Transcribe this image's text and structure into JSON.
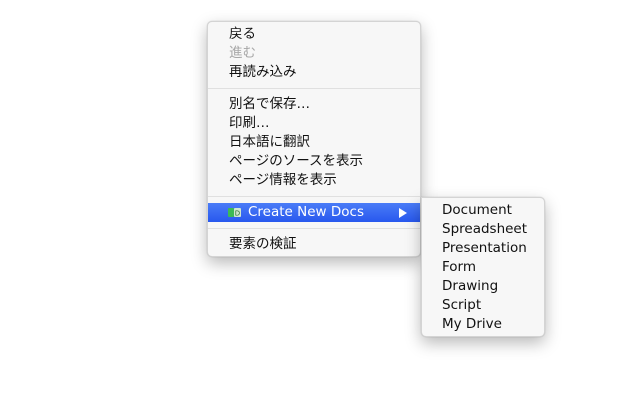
{
  "context_menu": {
    "nav_group": {
      "back": "戻る",
      "forward": "進む",
      "reload": "再読み込み"
    },
    "page_group": {
      "save_as": "別名で保存…",
      "print": "印刷…",
      "translate": "日本語に翻訳",
      "view_source": "ページのソースを表示",
      "page_info": "ページ情報を表示"
    },
    "extension_item": {
      "label": "Create New Docs",
      "icon": "google-docs-icon"
    },
    "inspect": "要素の検証"
  },
  "submenu": {
    "items": [
      "Document",
      "Spreadsheet",
      "Presentation",
      "Form",
      "Drawing",
      "Script",
      "My Drive"
    ]
  },
  "colors": {
    "highlight": "#2f63f5",
    "disabled_text": "#a8a8a8"
  }
}
